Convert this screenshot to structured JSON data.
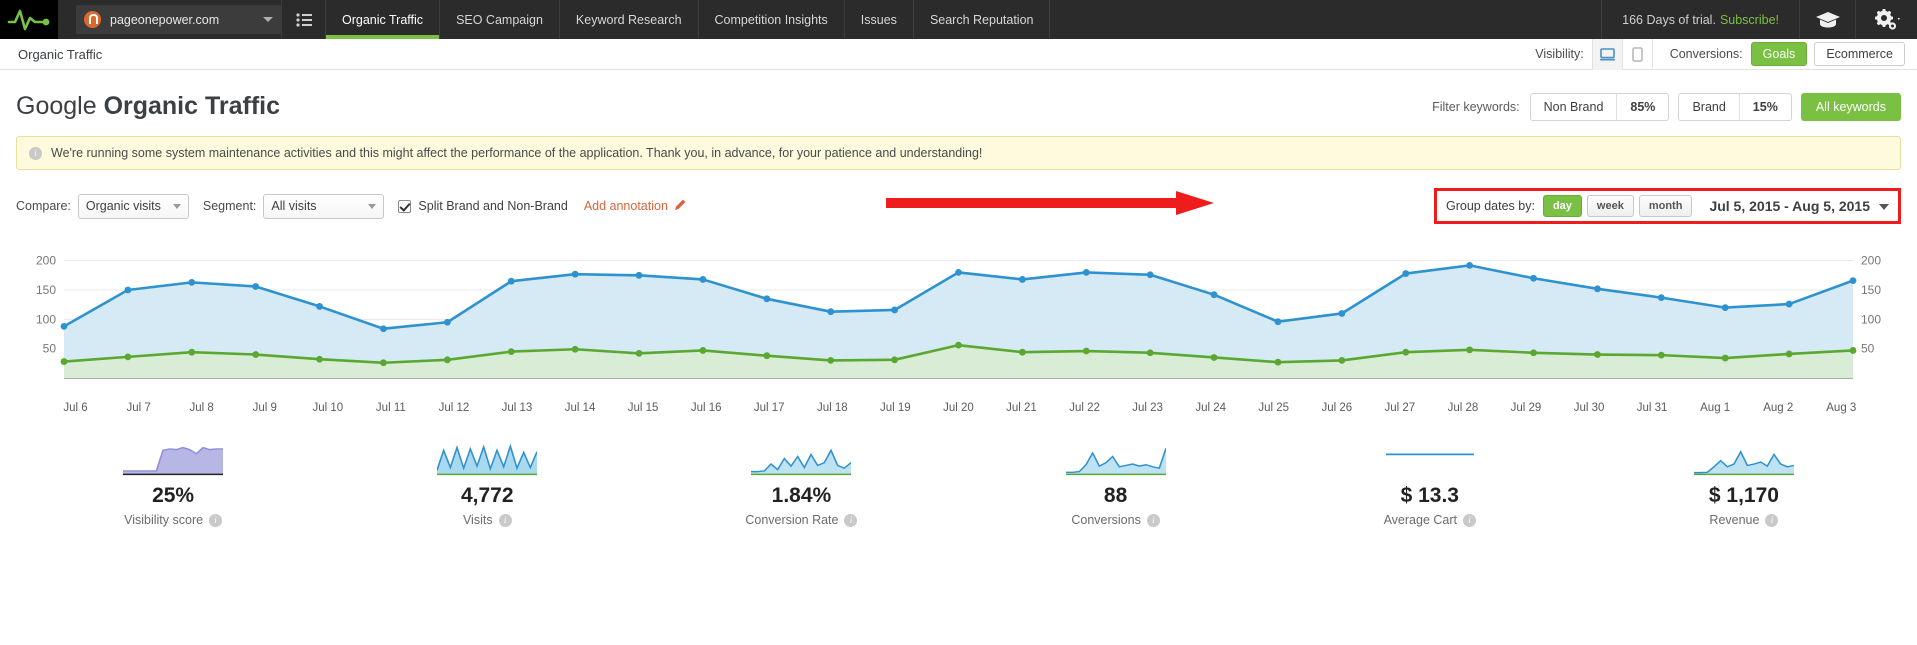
{
  "topnav": {
    "site": "pageonepower.com",
    "tabs": [
      {
        "label": "Organic Traffic",
        "active": true
      },
      {
        "label": "SEO Campaign",
        "active": false
      },
      {
        "label": "Keyword Research",
        "active": false
      },
      {
        "label": "Competition Insights",
        "active": false
      },
      {
        "label": "Issues",
        "active": false
      },
      {
        "label": "Search Reputation",
        "active": false
      }
    ],
    "trial_text": "166 Days of trial.",
    "trial_cta": "Subscribe!",
    "list_icon": "list-icon",
    "academy_icon": "graduation-cap-icon",
    "settings_icon": "gear-icon"
  },
  "subbar": {
    "title": "Organic Traffic",
    "visibility_label": "Visibility:",
    "desktop_icon": "desktop-icon",
    "mobile_icon": "mobile-icon",
    "conversions_label": "Conversions:",
    "goals_label": "Goals",
    "ecommerce_label": "Ecommerce"
  },
  "header": {
    "title_prefix": "Google ",
    "title_strong": "Organic Traffic",
    "filter_label": "Filter keywords:",
    "non_brand_label": "Non Brand",
    "non_brand_pct": "85%",
    "brand_label": "Brand",
    "brand_pct": "15%",
    "all_keywords_label": "All keywords"
  },
  "notice": {
    "text": "We're running some system maintenance activities and this might affect the performance of the application. Thank you, in advance, for your patience and understanding!"
  },
  "controls": {
    "compare_label": "Compare:",
    "compare_value": "Organic visits",
    "segment_label": "Segment:",
    "segment_value": "All visits",
    "split_label": "Split Brand and Non-Brand",
    "add_annotation_label": "Add annotation",
    "group_dates_label": "Group dates by:",
    "group_day": "day",
    "group_week": "week",
    "group_month": "month",
    "group_selected": "day",
    "date_range": "Jul 5, 2015 - Aug 5, 2015"
  },
  "colors": {
    "accent_green": "#7ac143",
    "series_blue": "#2e92d1",
    "series_green": "#5aa832",
    "highlight_red": "#ee1c1c",
    "notice_bg": "#fdfade"
  },
  "chart_data": {
    "type": "area",
    "title": "Google Organic Traffic",
    "xlabel": "",
    "ylabel": "",
    "ylim": [
      0,
      225
    ],
    "yticks": [
      50,
      100,
      150,
      200
    ],
    "grid": true,
    "legend": "none",
    "categories": [
      "Jul 6",
      "Jul 7",
      "Jul 8",
      "Jul 9",
      "Jul 10",
      "Jul 11",
      "Jul 12",
      "Jul 13",
      "Jul 14",
      "Jul 15",
      "Jul 16",
      "Jul 17",
      "Jul 18",
      "Jul 19",
      "Jul 20",
      "Jul 21",
      "Jul 22",
      "Jul 23",
      "Jul 24",
      "Jul 25",
      "Jul 26",
      "Jul 27",
      "Jul 28",
      "Jul 29",
      "Jul 30",
      "Jul 31",
      "Aug 1",
      "Aug 2",
      "Aug 3"
    ],
    "series": [
      {
        "name": "Non-Brand",
        "color": "#2e92d1",
        "values": [
          88,
          150,
          163,
          156,
          122,
          84,
          95,
          165,
          177,
          175,
          168,
          135,
          113,
          116,
          180,
          168,
          180,
          176,
          142,
          96,
          110,
          178,
          192,
          170,
          152,
          137,
          120,
          126,
          166
        ]
      },
      {
        "name": "Brand",
        "color": "#5aa832",
        "values": [
          28,
          36,
          44,
          40,
          32,
          26,
          31,
          45,
          49,
          42,
          47,
          38,
          30,
          31,
          56,
          44,
          46,
          43,
          35,
          27,
          30,
          44,
          48,
          43,
          40,
          39,
          34,
          41,
          47
        ]
      }
    ]
  },
  "kpis": [
    {
      "value": "25%",
      "label": "Visibility score",
      "spark": "visibility-sparkline",
      "color": "#8e8edb",
      "fill": "#b7b7e5"
    },
    {
      "value": "4,772",
      "label": "Visits",
      "spark": "visits-sparkline",
      "color": "#2e92d1",
      "fill": "#a9d9ee"
    },
    {
      "value": "1.84%",
      "label": "Conversion Rate",
      "spark": "conversion-rate-sparkline",
      "color": "#2e92d1",
      "fill": "#bfe2f2"
    },
    {
      "value": "88",
      "label": "Conversions",
      "spark": "conversions-sparkline",
      "color": "#2e92d1",
      "fill": "#bfe2f2"
    },
    {
      "value": "$ 13.3",
      "label": "Average Cart",
      "spark": "average-cart-sparkline",
      "color": "#2e92d1",
      "fill": "#bfe2f2"
    },
    {
      "value": "$ 1,170",
      "label": "Revenue",
      "spark": "revenue-sparkline",
      "color": "#2e92d1",
      "fill": "#bfe2f2"
    }
  ]
}
